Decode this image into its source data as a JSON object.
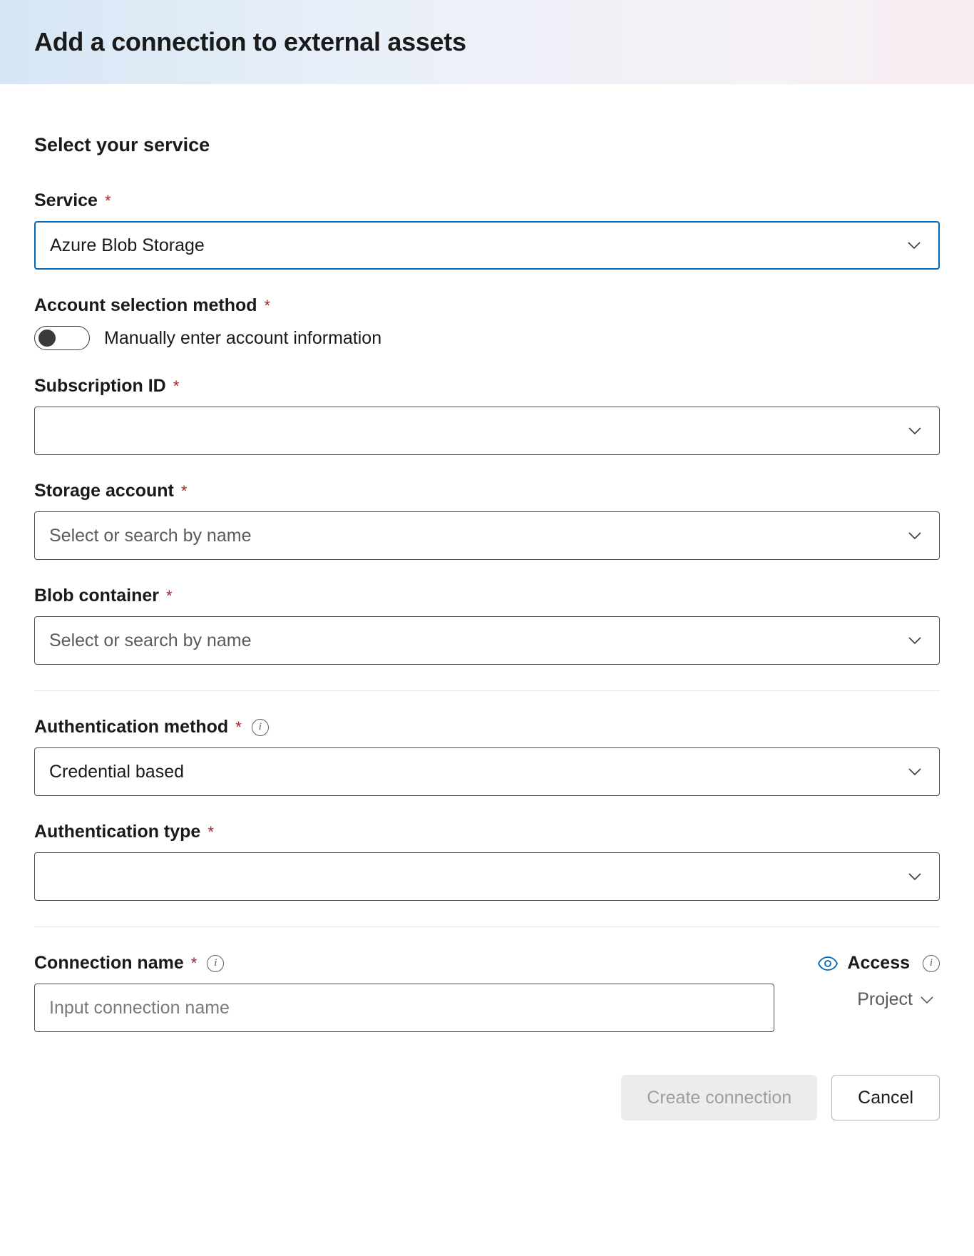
{
  "header": {
    "title": "Add a connection to external assets"
  },
  "section": {
    "title": "Select your service"
  },
  "fields": {
    "service": {
      "label": "Service",
      "value": "Azure Blob Storage"
    },
    "accountSelection": {
      "label": "Account selection method",
      "toggleLabel": "Manually enter account information"
    },
    "subscription": {
      "label": "Subscription ID",
      "value": ""
    },
    "storageAccount": {
      "label": "Storage account",
      "placeholder": "Select or search by name"
    },
    "blobContainer": {
      "label": "Blob container",
      "placeholder": "Select or search by name"
    },
    "authMethod": {
      "label": "Authentication method",
      "value": "Credential based"
    },
    "authType": {
      "label": "Authentication type",
      "value": ""
    },
    "connectionName": {
      "label": "Connection name",
      "placeholder": "Input connection name"
    },
    "access": {
      "label": "Access",
      "value": "Project"
    }
  },
  "buttons": {
    "create": "Create connection",
    "cancel": "Cancel"
  }
}
